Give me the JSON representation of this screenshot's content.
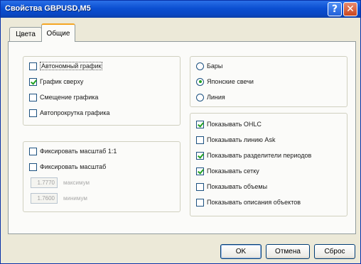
{
  "window": {
    "title": "Свойства GBPUSD,M5",
    "help_glyph": "?",
    "close_glyph": "✕"
  },
  "tabs": [
    {
      "label": "Цвета",
      "active": false
    },
    {
      "label": "Общие",
      "active": true
    }
  ],
  "chart_options": [
    {
      "label": "Автономный график",
      "checked": false
    },
    {
      "label": "График сверху",
      "checked": true
    },
    {
      "label": "Смещение графика",
      "checked": false
    },
    {
      "label": "Автопрокрутка графика",
      "checked": false
    }
  ],
  "scale_options": [
    {
      "label": "Фиксировать масштаб 1:1",
      "checked": false
    },
    {
      "label": "Фиксировать масштаб",
      "checked": false
    }
  ],
  "scale_fields": [
    {
      "value": "1.7770",
      "label": "максимум"
    },
    {
      "value": "1.7600",
      "label": "минимум"
    }
  ],
  "chart_type": [
    {
      "label": "Бары",
      "selected": false
    },
    {
      "label": "Японские свечи",
      "selected": true
    },
    {
      "label": "Линия",
      "selected": false
    }
  ],
  "show_options": [
    {
      "label": "Показывать OHLC",
      "checked": true
    },
    {
      "label": "Показывать линию Ask",
      "checked": false
    },
    {
      "label": "Показывать разделители периодов",
      "checked": true
    },
    {
      "label": "Показывать сетку",
      "checked": true
    },
    {
      "label": "Показывать объемы",
      "checked": false
    },
    {
      "label": "Показывать описания объектов",
      "checked": false
    }
  ],
  "buttons": {
    "ok": "OK",
    "cancel": "Отмена",
    "reset": "Сброс"
  }
}
